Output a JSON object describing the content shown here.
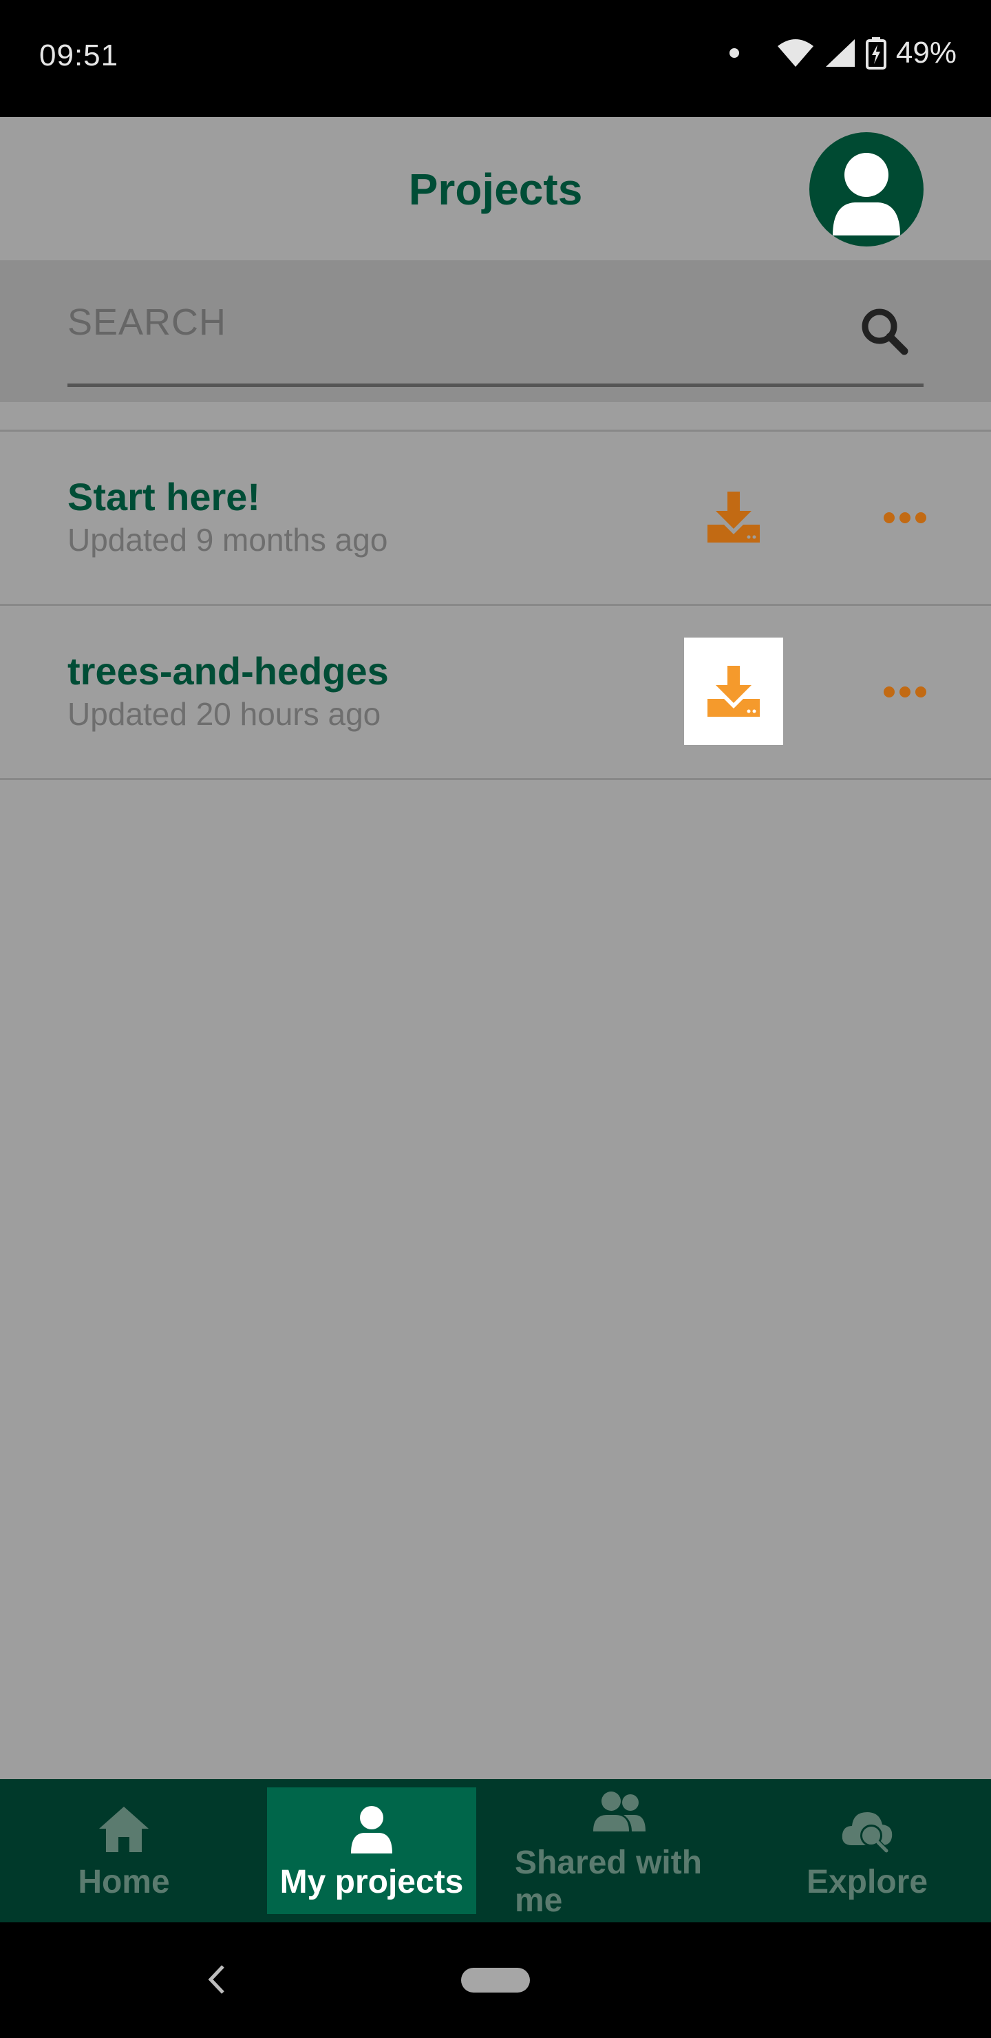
{
  "status_bar": {
    "time": "09:51",
    "battery": "49%"
  },
  "header": {
    "title": "Projects"
  },
  "search": {
    "placeholder": "SEARCH"
  },
  "projects": [
    {
      "name": "Start here!",
      "updated": "Updated 9 months ago"
    },
    {
      "name": "trees-and-hedges",
      "updated": "Updated 20 hours ago"
    }
  ],
  "bottom_nav": {
    "items": [
      {
        "label": "Home",
        "icon": "home-icon"
      },
      {
        "label": "My projects",
        "icon": "person-icon",
        "active": true
      },
      {
        "label": "Shared with me",
        "icon": "people-icon"
      },
      {
        "label": "Explore",
        "icon": "cloud-search-icon"
      }
    ]
  },
  "colors": {
    "brand_dark": "#004d36",
    "accent_orange": "#c26a13",
    "active_nav": "#00664a"
  }
}
